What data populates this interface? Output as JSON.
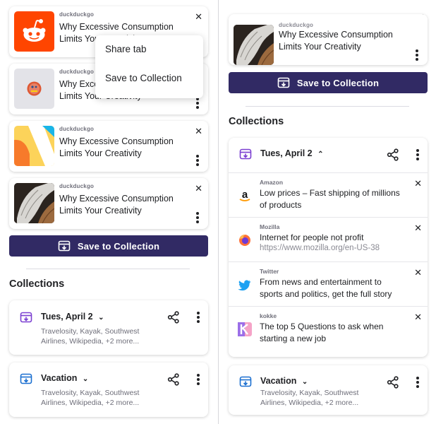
{
  "left": {
    "tabs": [
      {
        "source": "duckduckgo",
        "title": "Why Excessive Consumption Limits Your Creativity",
        "thumb": "reddit-logo"
      },
      {
        "source": "duckduckgo",
        "title": "Why Excessive Consumption Limits Your Creativity",
        "thumb": "duckduckgo-logo"
      },
      {
        "source": "duckduckgo",
        "title": "Why Excessive Consumption Limits Your Creativity",
        "thumb": "abstract-art"
      },
      {
        "source": "duckduckgo",
        "title": "Why Excessive Consumption Limits Your Creativity",
        "thumb": "wood-texture"
      }
    ],
    "context_menu": {
      "items": [
        "Share tab",
        "Save to Collection"
      ]
    },
    "save_button": "Save to Collection",
    "collections_heading": "Collections",
    "collections": [
      {
        "title": "Tues, April 2",
        "subtitle": "Travelosity, Kayak, Southwest Airlines, Wikipedia, +2 more..."
      },
      {
        "title": "Vacation",
        "subtitle": "Travelosity, Kayak, Southwest Airlines, Wikipedia, +2 more..."
      }
    ]
  },
  "right": {
    "tab": {
      "source": "duckduckgo",
      "title": "Why Excessive Consumption Limits Your Creativity",
      "thumb": "wood-texture"
    },
    "save_button": "Save to Collection",
    "collections_heading": "Collections",
    "expanded_collection": {
      "title": "Tues, April 2",
      "items": [
        {
          "source": "Amazon",
          "title": "Low prices – Fast shipping of millions of products",
          "url": "",
          "icon": "amazon-icon"
        },
        {
          "source": "Mozilla",
          "title": "Internet for people not profit",
          "url": "https://www.mozilla.org/en-US-38",
          "icon": "firefox-icon"
        },
        {
          "source": "Twitter",
          "title": "From news and entertainment to sports and politics, get the full story",
          "url": "",
          "icon": "twitter-icon"
        },
        {
          "source": "kokke",
          "title": "The top 5 Questions to ask when starting a new job",
          "url": "",
          "icon": "kokke-icon"
        }
      ]
    },
    "collapsed_collection": {
      "title": "Vacation",
      "subtitle": "Travelosity, Kayak, Southwest Airlines, Wikipedia, +2 more..."
    }
  },
  "colors": {
    "primary": "#312a64",
    "collection_icon_purple": "#7b3fd1",
    "collection_icon_blue": "#1b6fd0"
  }
}
